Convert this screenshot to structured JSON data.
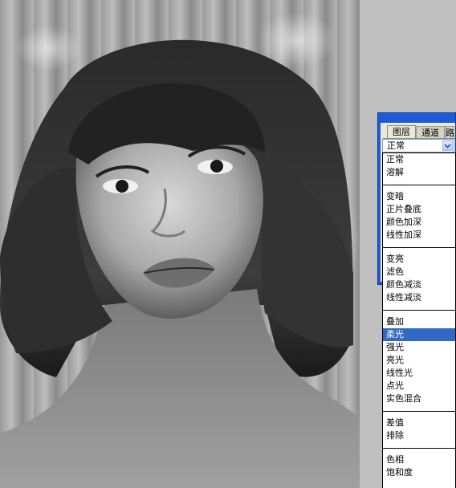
{
  "panel": {
    "tabs": [
      {
        "label": "图层"
      },
      {
        "label": "通道"
      },
      {
        "label": "路"
      }
    ]
  },
  "blend_mode": {
    "selected_value": "正常",
    "groups": [
      [
        "正常",
        "溶解"
      ],
      [
        "变暗",
        "正片叠底",
        "颜色加深",
        "线性加深"
      ],
      [
        "变亮",
        "滤色",
        "颜色减淡",
        "线性减淡"
      ],
      [
        "叠加",
        "柔光",
        "强光",
        "亮光",
        "线性光",
        "点光",
        "实色混合"
      ],
      [
        "差值",
        "排除"
      ],
      [
        "色相",
        "饱和度"
      ]
    ],
    "highlighted": "柔光"
  },
  "icons": {
    "dropdown_arrow": "chevron-down-icon"
  },
  "colors": {
    "panel_title": "#1d5bd6",
    "highlight": "#316ac5",
    "panel_bg": "#ece9d8"
  }
}
